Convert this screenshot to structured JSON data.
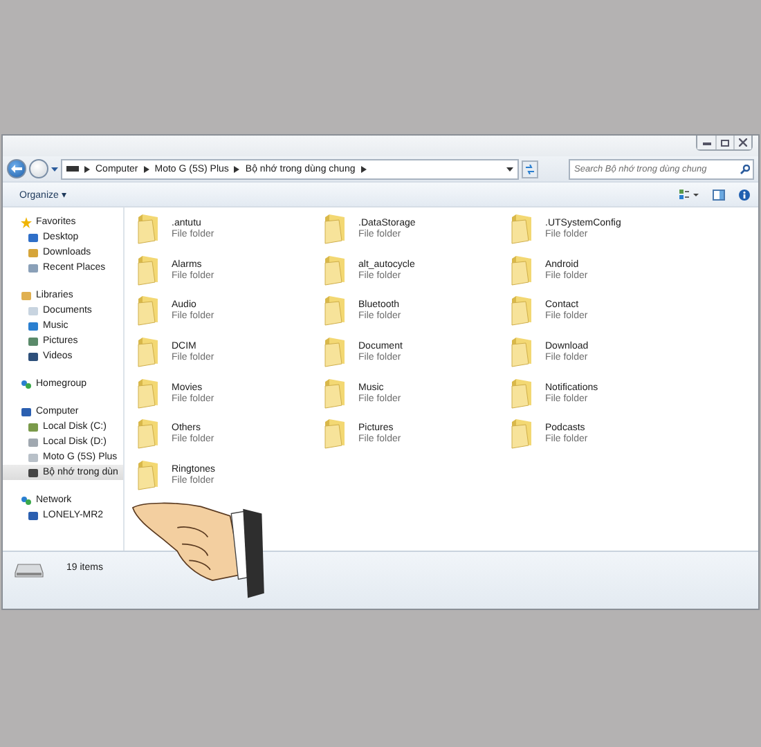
{
  "address": {
    "crumbs": [
      "Computer",
      "Moto G (5S) Plus",
      "Bộ nhớ trong dùng chung"
    ]
  },
  "search": {
    "placeholder": "Search Bộ nhớ trong dùng chung"
  },
  "toolbar": {
    "organize": "Organize ▾"
  },
  "sidebar": {
    "groups": [
      {
        "label": "Favorites",
        "children": [
          {
            "label": "Desktop",
            "selected": false
          },
          {
            "label": "Downloads",
            "selected": false
          },
          {
            "label": "Recent Places",
            "selected": false
          }
        ]
      },
      {
        "label": "Libraries",
        "children": [
          {
            "label": "Documents",
            "selected": false
          },
          {
            "label": "Music",
            "selected": false
          },
          {
            "label": "Pictures",
            "selected": false
          },
          {
            "label": "Videos",
            "selected": false
          }
        ]
      },
      {
        "label": "Homegroup"
      },
      {
        "label": "Computer",
        "children": [
          {
            "label": "Local Disk (C:)",
            "selected": false
          },
          {
            "label": "Local Disk (D:)",
            "selected": false
          },
          {
            "label": "Moto G (5S) Plus",
            "selected": false
          },
          {
            "label": "Bộ nhớ trong dùn",
            "selected": true
          }
        ]
      },
      {
        "label": "Network",
        "children": [
          {
            "label": "LONELY-MR2",
            "selected": false
          }
        ]
      }
    ]
  },
  "files": [
    {
      "name": ".antutu",
      "type": "File folder"
    },
    {
      "name": ".DataStorage",
      "type": "File folder"
    },
    {
      "name": ".UTSystemConfig",
      "type": "File folder"
    },
    {
      "name": "Alarms",
      "type": "File folder"
    },
    {
      "name": "alt_autocycle",
      "type": "File folder"
    },
    {
      "name": "Android",
      "type": "File folder"
    },
    {
      "name": "Audio",
      "type": "File folder"
    },
    {
      "name": "Bluetooth",
      "type": "File folder"
    },
    {
      "name": "Contact",
      "type": "File folder"
    },
    {
      "name": "DCIM",
      "type": "File folder"
    },
    {
      "name": "Document",
      "type": "File folder"
    },
    {
      "name": "Download",
      "type": "File folder"
    },
    {
      "name": "Movies",
      "type": "File folder"
    },
    {
      "name": "Music",
      "type": "File folder"
    },
    {
      "name": "Notifications",
      "type": "File folder"
    },
    {
      "name": "Others",
      "type": "File folder"
    },
    {
      "name": "Pictures",
      "type": "File folder"
    },
    {
      "name": "Podcasts",
      "type": "File folder"
    },
    {
      "name": "Ringtones",
      "type": "File folder"
    }
  ],
  "status_bar": {
    "count": "19 items"
  }
}
